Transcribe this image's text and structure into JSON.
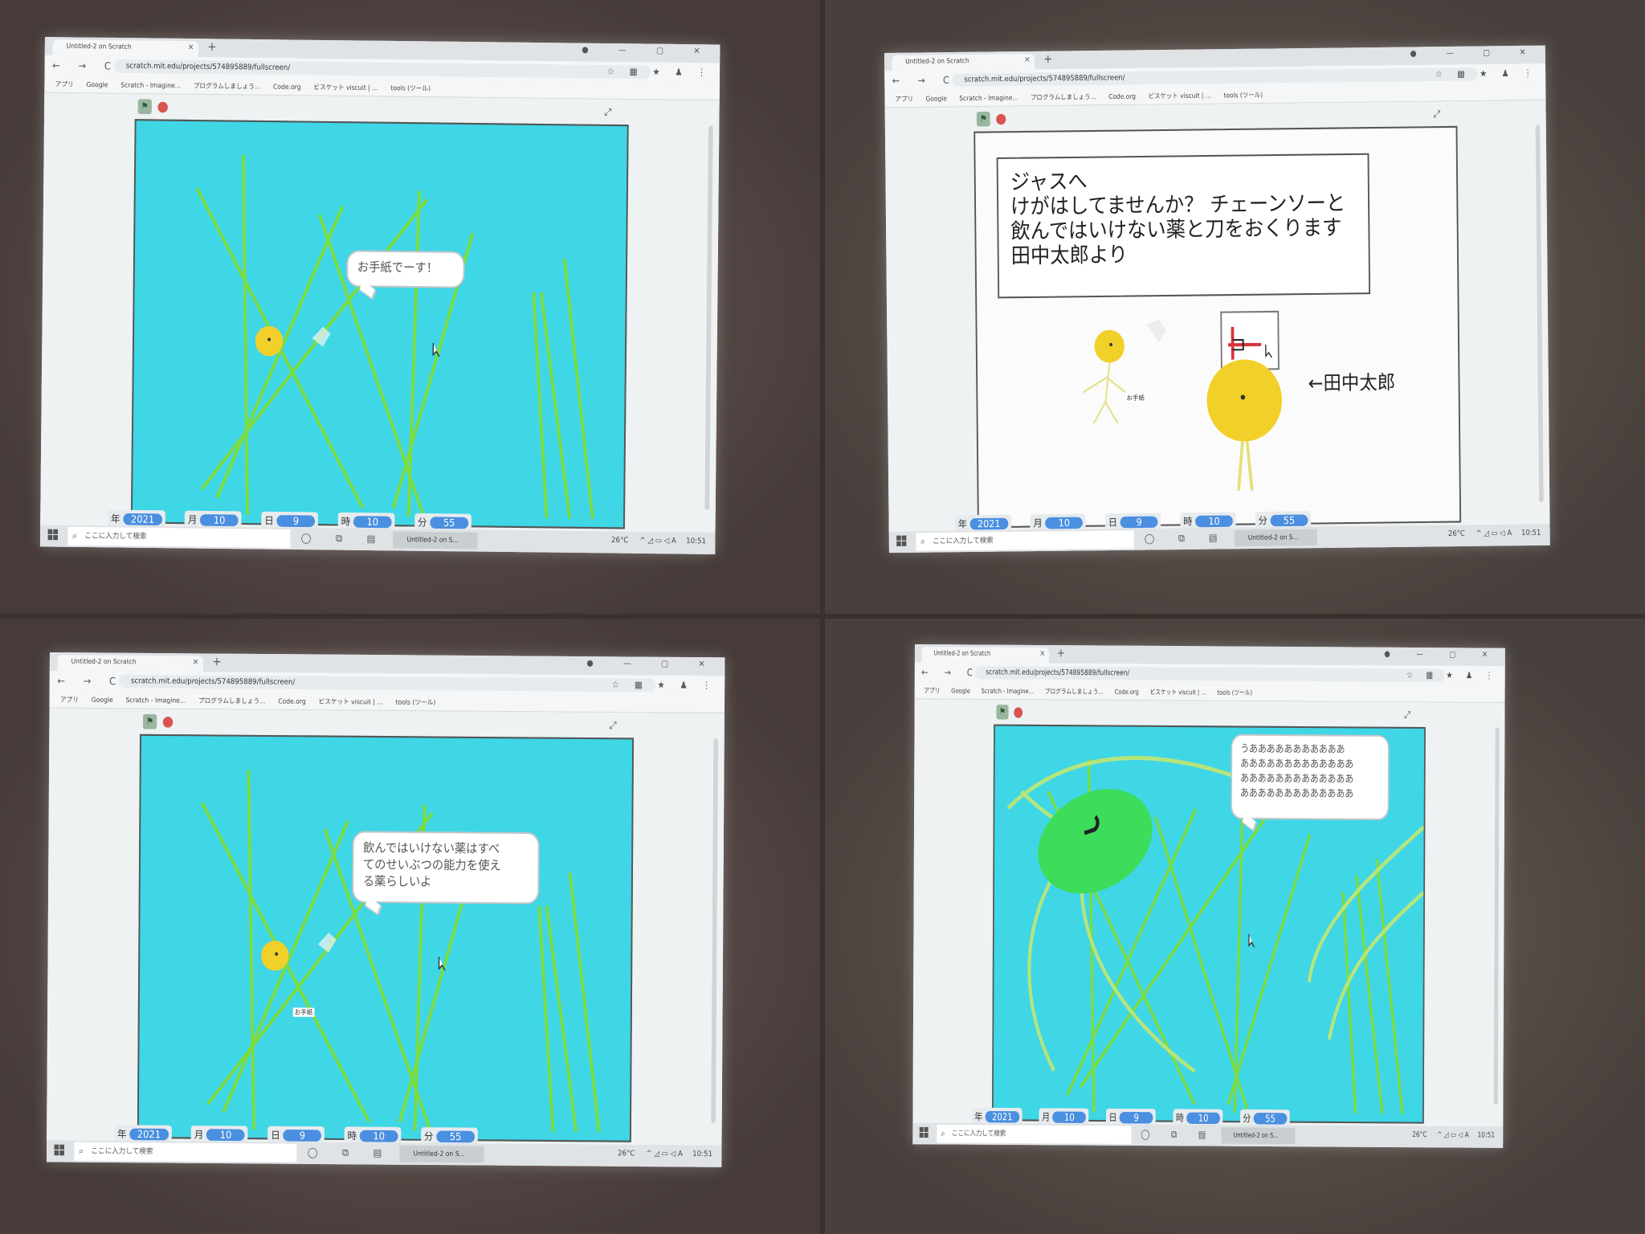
{
  "browser": {
    "tab_title": "Untitled-2 on Scratch",
    "tab_close": "×",
    "new_tab": "+",
    "window_controls": "● — ▢ ✕",
    "nav_buttons": "← → C",
    "url": "scratch.mit.edu/projects/574895889/fullscreen/",
    "ext_icons": "☆ ▦ ★ ♟ ⋮",
    "bookmarks": [
      "アプリ",
      "Google",
      "Scratch - Imagine...",
      "プログラムしましょう...",
      "Code.org",
      "ビスケット viscuit | ...",
      "tools (ツール)"
    ]
  },
  "player": {
    "flag_glyph": "⚑",
    "fullscreen_glyph": "⤢"
  },
  "date_display": [
    {
      "label": "年",
      "value": "2021"
    },
    {
      "label": "月",
      "value": "10"
    },
    {
      "label": "日",
      "value": "9"
    },
    {
      "label": "時",
      "value": "10"
    },
    {
      "label": "分",
      "value": "55"
    }
  ],
  "scenes": [
    {
      "bubble": "お手紙でーす！"
    },
    {
      "letter_lines": [
        "ジャスへ",
        "けがはしてませんか？ チェーンソーと",
        "飲んではいけない薬と刀をおくります",
        "田中太郎より"
      ],
      "arrow_label": "←田中太郎",
      "small_label": "お手紙"
    },
    {
      "bubble_lines": [
        "飲んではいけない薬はすべ",
        "てのせいぶつの能力を使え",
        "る薬らしいよ"
      ],
      "small_label": "お手紙"
    },
    {
      "bubble_lines": [
        "うあああああああああああ",
        "あああああああああああああ",
        "あああああああああああああ",
        "あああああああああああああ"
      ]
    }
  ],
  "taskbar": {
    "search_icon": "⌕",
    "search_placeholder": "ここに入力して検索",
    "task_icons": "◯ ⧉ ▤",
    "app_title": "Untitled-2 on S...",
    "temperature": "26°C",
    "tray_icons": "^ ◿ ▭ ◁ A",
    "clock": "10:51"
  },
  "colors": {
    "stage_bg": "#3fd6e6",
    "grass": "#7ddc3e",
    "sun": "#f2d02a",
    "date_value_bg": "#4a8fe0"
  }
}
